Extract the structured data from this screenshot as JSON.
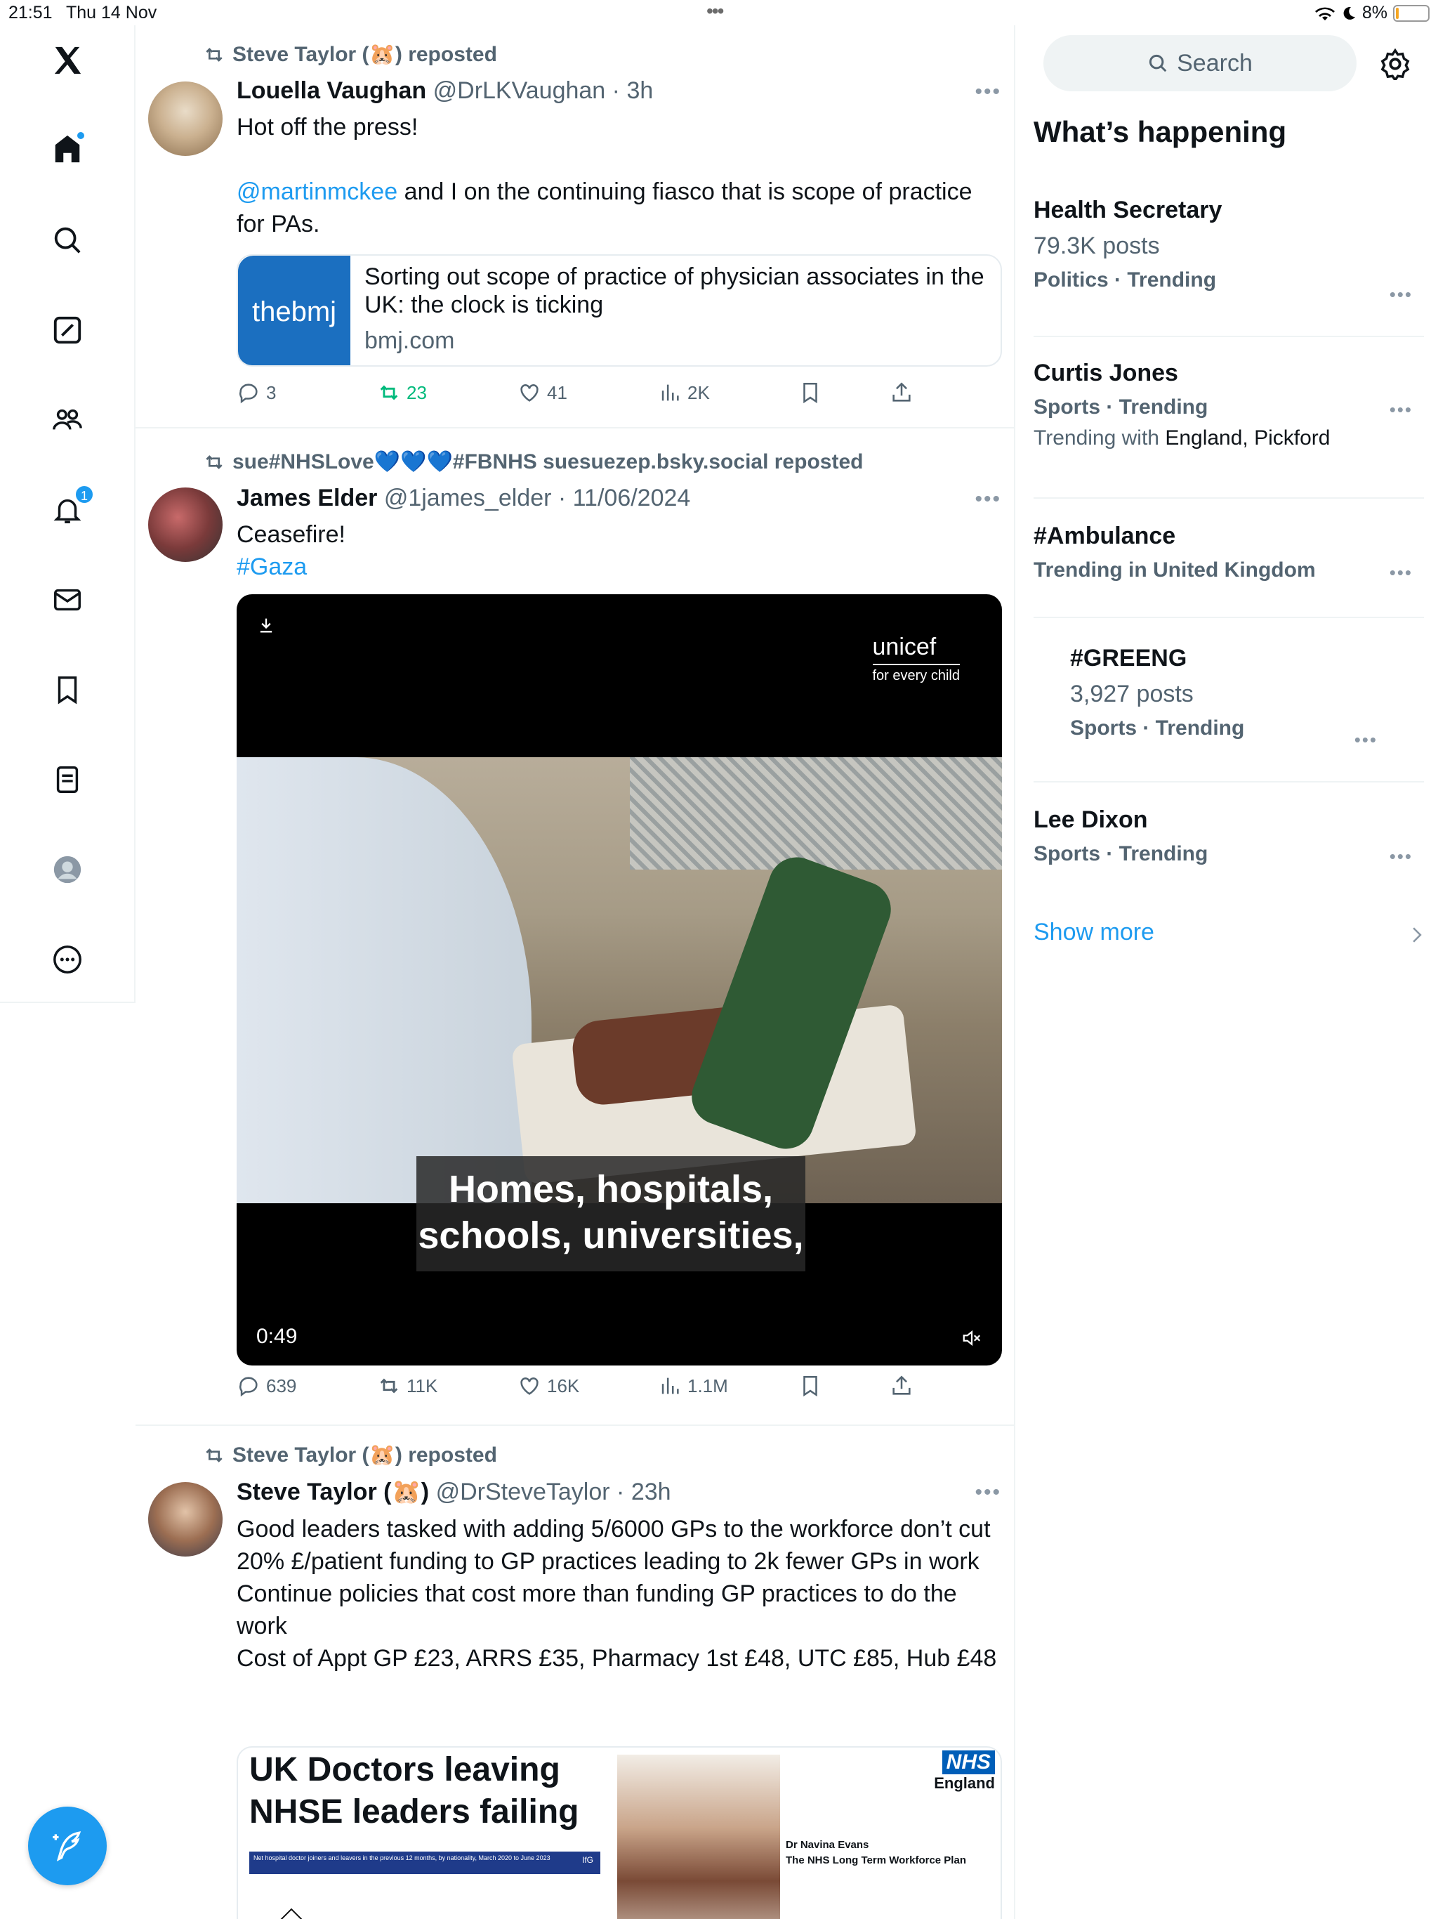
{
  "status_bar": {
    "time": "21:51",
    "date": "Thu 14 Nov",
    "battery": "8%"
  },
  "nav": {
    "items": [
      "x-logo",
      "home",
      "explore",
      "grok",
      "communities",
      "notifications",
      "messages",
      "bookmarks",
      "lists",
      "profile",
      "more"
    ],
    "notifications_badge": "1"
  },
  "feed": {
    "posts": [
      {
        "reposted_by": "Steve Taylor (🐹) reposted",
        "name": "Louella Vaughan",
        "handle": "@DrLKVaughan",
        "time": "· 3h",
        "line1": "Hot off the press!",
        "mention": "@martinmckee",
        "line2": " and I on the continuing fiasco that is scope of practice for PAs.",
        "card_logo": "thebmj",
        "card_title": "Sorting out scope of practice of physician associates in the UK: the clock is ticking",
        "card_domain": "bmj.com",
        "replies": "3",
        "reposts": "23",
        "likes": "41",
        "views": "2K"
      },
      {
        "reposted_by": "sue#NHSLove💙💙💙#FBNHS suesuezep.bsky.social reposted",
        "name": "James Elder",
        "handle": "@1james_elder",
        "time": "· 11/06/2024",
        "line1": "Ceasefire!",
        "hashtag": "#Gaza",
        "video_brand": "unicef",
        "video_tagline": "for every child",
        "caption": "Homes, hospitals, schools, universities,",
        "duration": "0:49",
        "replies": "639",
        "reposts": "11K",
        "likes": "16K",
        "views": "1.1M"
      },
      {
        "reposted_by": "Steve Taylor (🐹) reposted",
        "name": "Steve Taylor (🐹)",
        "handle": "@DrSteveTaylor",
        "time": "· 23h",
        "text": [
          "Good leaders tasked with adding 5/6000 GPs to the workforce don’t cut 20% £/patient funding to GP practices leading to 2k fewer GPs in work",
          "Continue policies that cost more than funding GP practices to do the work",
          "Cost of Appt GP £23, ARRS £35, Pharmacy 1st £48, UTC £85, Hub £48"
        ],
        "img_headline1": "UK Doctors leaving",
        "img_headline2": "NHSE leaders failing",
        "img_chart_title": "Net hospital doctor joiners and leavers in the previous 12 months, by nationality, March 2020 to June 2023",
        "img_chart_brand": "IfG",
        "img_nhs": "NHS",
        "img_england": "England",
        "img_person": "Dr Navina Evans",
        "img_plan": "The NHS Long Term Workforce Plan"
      }
    ]
  },
  "sidebar": {
    "search_placeholder": "Search",
    "heading": "What’s happening",
    "trends": [
      {
        "title": "Health Secretary",
        "posts": "79.3K posts",
        "context": "Politics · Trending"
      },
      {
        "title": "Curtis Jones",
        "context": "Sports · Trending",
        "with_label": "Trending with ",
        "with": "England, Pickford"
      },
      {
        "title": "#Ambulance",
        "context": "Trending in United Kingdom"
      },
      {
        "title": "#GREENG",
        "posts": "3,927 posts",
        "context": "Sports · Trending"
      },
      {
        "title": "Lee Dixon",
        "context": "Sports · Trending"
      }
    ],
    "show_more": "Show more"
  },
  "colors": {
    "accent": "#1d9bf0",
    "repost_active": "#00ba7c",
    "muted": "#536471"
  }
}
